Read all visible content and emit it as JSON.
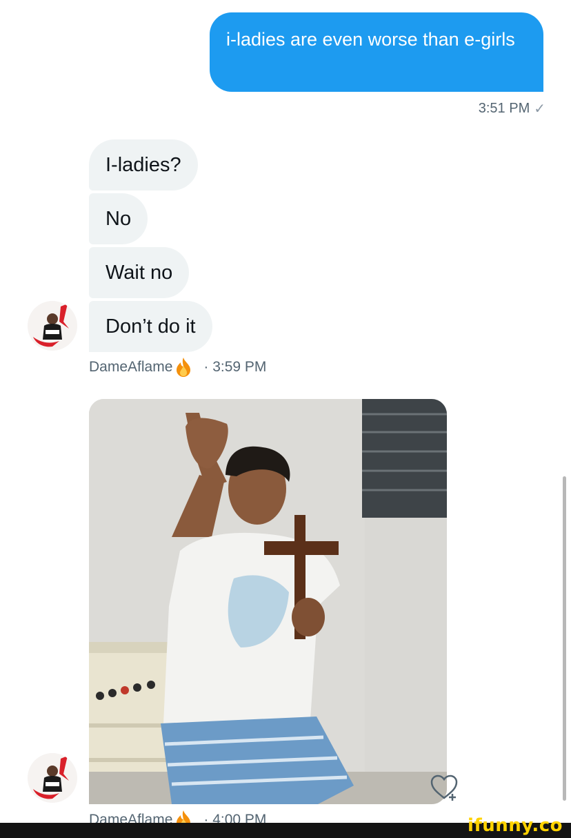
{
  "conversation": {
    "sent": {
      "text": "i-ladies are even worse than e-girls",
      "time": "3:51 PM",
      "status_icon": "check-icon"
    },
    "received_group_1": {
      "messages": [
        "I-ladies?",
        "No",
        "Wait no",
        "Don’t do it"
      ],
      "sender": "DameAflame",
      "sender_icon": "fire-icon",
      "time": "· 3:59 PM"
    },
    "received_group_2": {
      "attachment": "photo",
      "sender": "DameAflame",
      "sender_icon": "fire-icon",
      "time": "· 4:00 PM"
    }
  },
  "watermark": "ifunny.co",
  "colors": {
    "sent_bubble": "#1d9bf0",
    "received_bubble": "#eff3f4",
    "meta_text": "#536471",
    "watermark": "#ffd200"
  }
}
